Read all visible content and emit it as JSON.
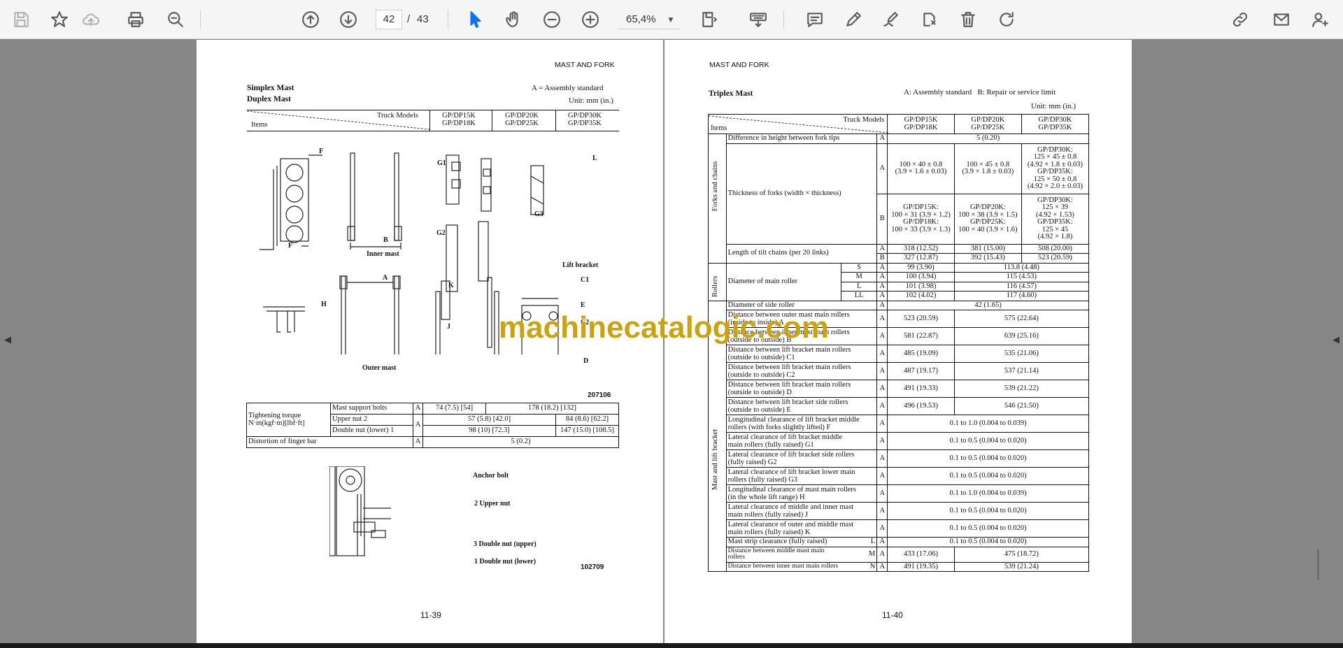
{
  "toolbar": {
    "page_current": "42",
    "page_separator": "/",
    "page_total": "43",
    "zoom": "65,4%",
    "icons": [
      "save-icon",
      "bookmark-star-icon",
      "upload-cloud-icon",
      "print-icon",
      "zoom-search-icon",
      "page-up-icon",
      "page-down-icon",
      "select-arrow-icon",
      "hand-icon",
      "zoom-out-icon",
      "zoom-in-icon",
      "fit-page-icon",
      "keyboard-icon",
      "comment-icon",
      "pen-icon",
      "sign-icon",
      "stamp-icon",
      "delete-icon",
      "rotate-icon",
      "link-icon",
      "mail-icon",
      "user-icon"
    ]
  },
  "page1": {
    "header": "MAST AND FORK",
    "title1": "Simplex Mast",
    "title2": "Duplex Mast",
    "legend": "A = Assembly standard",
    "unit": "Unit: mm (in.)",
    "col_truck": "Truck Models",
    "col_items": "Items",
    "models": [
      [
        "GP/DP15K",
        "GP/DP18K"
      ],
      [
        "GP/DP20K",
        "GP/DP25K"
      ],
      [
        "GP/DP30K",
        "GP/DP35K"
      ]
    ],
    "fig_labels": {
      "F1": "F",
      "F2": "F",
      "B": "B",
      "inner": "Inner mast",
      "G1": "G1",
      "G3": "G3",
      "L": "L",
      "G2": "G2",
      "K": "K",
      "J": "J",
      "A": "A",
      "H": "H",
      "outer": "Outer mast",
      "liftbracket": "Lift bracket",
      "C1": "C1",
      "E": "E",
      "C2": "C2",
      "D": "D",
      "code": "207106"
    },
    "torque": {
      "label1": "Tightening torque",
      "label2": "N·m(kgf·m)[lbf·ft]",
      "rows": [
        {
          "item": "Mast support bolts",
          "std": "A",
          "v1": "74 (7.5) [54]",
          "v2": "178 (18.2) [132]"
        },
        {
          "item": "Upper nut 2",
          "std": "A",
          "v1": "57 (5.8) [42.0]",
          "v2": "84 (8.6) [62.2]"
        },
        {
          "item": "Double nut (lower) 1",
          "std": "",
          "v1": "98 (10) [72.3]",
          "v2": "147 (15.0) [108.5]"
        }
      ],
      "distortion": "Distortion of finger bar",
      "dist_std": "A",
      "dist_val": "5 (0.2)"
    },
    "fig2": {
      "anchor": "Anchor bolt",
      "upper": "2 Upper nut",
      "dbl_up": "3 Double nut (upper)",
      "dbl_low": "1 Double nut (lower)",
      "code": "102709"
    },
    "page_no": "11-39"
  },
  "page2": {
    "header": "MAST AND FORK",
    "title": "Triplex Mast",
    "legend": "A: Assembly standard   B: Repair or service limit",
    "unit": "Unit: mm (in.)",
    "col_truck": "Truck Models",
    "col_items": "Items",
    "models": [
      [
        "GP/DP15K",
        "GP/DP18K"
      ],
      [
        "GP/DP20K",
        "GP/DP25K"
      ],
      [
        "GP/DP30K",
        "GP/DP35K"
      ]
    ],
    "group_forks": "Forks and chains",
    "group_rollers": "Rollers",
    "group_mast": "Mast and lift bracket",
    "fork_rows": [
      {
        "item": "Difference in height between fork tips",
        "std": "A",
        "span": "5 (0.20)"
      },
      {
        "item": "Thickness of forks (width × thickness)",
        "std": "A",
        "v1": "100 × 40 ± 0.8\n(3.9 × 1.6 ± 0.03)",
        "v2": "100 × 45 ± 0.8\n(3.9 × 1.8 ± 0.03)",
        "v3": "GP/DP30K:\n125 × 45 ± 0.8\n(4.92 × 1.8 ± 0.03)\nGP/DP35K:\n125 × 50 ± 0.8\n(4.92 × 2.0 ± 0.03)"
      },
      {
        "std": "B",
        "v1": "GP/DP15K:\n100 × 31 (3.9 × 1.2)\nGP/DP18K:\n100 × 33 (3.9 × 1.3)",
        "v2": "GP/DP20K:\n100 × 38 (3.9 × 1.5)\nGP/DP25K:\n100 × 40 (3.9 × 1.6)",
        "v3": "GP/DP30K:\n125 × 39\n(4.92 × 1.53)\nGP/DP35K:\n125 × 45\n(4.92 × 1.8)"
      },
      {
        "item": "Length of tilt chains (per 20 links)",
        "std": "A",
        "v1": "318 (12.52)",
        "v2": "381 (15.00)",
        "v3": "508 (20.00)"
      },
      {
        "std": "B",
        "v1": "327 (12.87)",
        "v2": "392 (15.43)",
        "v3": "523 (20.59)"
      }
    ],
    "roller_main": "Diameter of main roller",
    "roller_rows": [
      {
        "size": "S",
        "std": "A",
        "v1": "99 (3.90)",
        "v23": "113.8 (4.48)"
      },
      {
        "size": "M",
        "std": "A",
        "v1": "100 (3.94)",
        "v23": "115 (4.53)"
      },
      {
        "size": "L",
        "std": "A",
        "v1": "101 (3.98)",
        "v23": "116 (4.57)"
      },
      {
        "size": "LL",
        "std": "A",
        "v1": "102  (4.02)",
        "v23": "117 (4.60)"
      }
    ],
    "side_roller": {
      "item": "Diameter of side roller",
      "std": "A",
      "val": "42 (1.65)"
    },
    "mast_rows": [
      {
        "item": "Distance between outer mast main rollers\n(inside to inside) A",
        "std": "A",
        "v1": "523 (20.59)",
        "v23": "575 (22.64)"
      },
      {
        "item": "Distance between inner mast main rollers\n(outside to outside) B",
        "std": "A",
        "v1": "581 (22.87)",
        "v23": "639 (25.16)"
      },
      {
        "item": "Distance between lift bracket main rollers\n(outside to outside) C1",
        "std": "A",
        "v1": "485 (19.09)",
        "v23": "535 (21.06)"
      },
      {
        "item": "Distance between lift bracket main rollers\n(outside to outside) C2",
        "std": "A",
        "v1": "487 (19.17)",
        "v23": "537 (21.14)"
      },
      {
        "item": "Distance between lift bracket main rollers\n(outside to outside) D",
        "std": "A",
        "v1": "491 (19.33)",
        "v23": "539 (21.22)"
      },
      {
        "item": "Distance between lift bracket side rollers\n(outside to outside) E",
        "std": "A",
        "v1": "496 (19.53)",
        "v23": "546 (21.50)"
      }
    ],
    "clear_rows": [
      {
        "item": "Longitudinal clearance of lift bracket middle\nrollers (with forks slightly lifted) F",
        "std": "A",
        "val": "0.1 to 1.0 (0.004 to 0.039)"
      },
      {
        "item": "Lateral clearance of lift bracket middle\nmain rollers (fully raised) G1",
        "std": "A",
        "val": "0.1 to 0.5 (0.004 to 0.020)"
      },
      {
        "item": "Lateral clearance of lift bracket side rollers\n(fully raised) G2",
        "std": "A",
        "val": "0.1 to 0.5 (0.004 to 0.020)"
      },
      {
        "item": "Lateral clearance of lift bracket lower main\nrollers (fully raised) G3",
        "std": "A",
        "val": "0.1 to 0.5 (0.004 to 0.020)"
      },
      {
        "item": "Longitudinal clearance of mast main rollers\n(in the whole lift range) H",
        "std": "A",
        "val": "0.1 to 1.0 (0.004 to 0.039)"
      },
      {
        "item": "Lateral clearance of middle and inner mast\nmain rollers (fully raised) J",
        "std": "A",
        "val": "0.1 to 0.5 (0.004 to 0.020)"
      },
      {
        "item": "Lateral clearance of outer and middle mast\nmain rollers (fully raised) K",
        "std": "A",
        "val": "0.1 to 0.5 (0.004 to 0.020)"
      },
      {
        "item": "Mast strip clearance (fully raised)",
        "sub": "L",
        "std": "A",
        "val": "0.1 to 0.5 (0.004 to 0.020)"
      }
    ],
    "dist_rows": [
      {
        "item": "Distance between middle mast main rollers",
        "sub": "M",
        "std": "A",
        "v1": "433 (17.06)",
        "v23": "475 (18.72)"
      },
      {
        "item": "Distance between inner mast main rollers",
        "sub": "N",
        "std": "A",
        "v1": "491 (19.35)",
        "v23": "539 (21.24)"
      }
    ],
    "page_no": "11-40"
  },
  "watermark": "machinecatalogic.com"
}
